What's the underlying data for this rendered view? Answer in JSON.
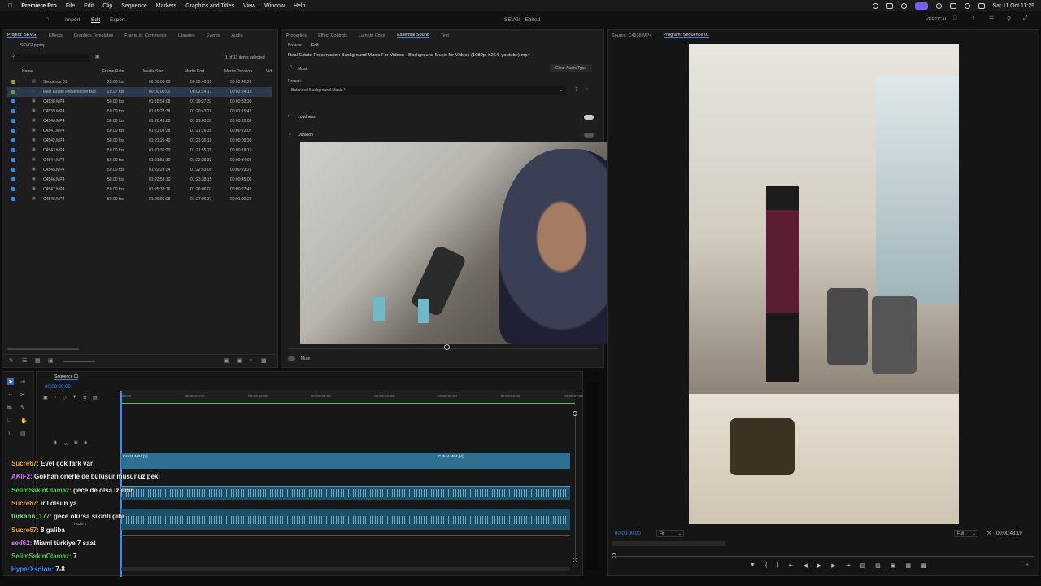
{
  "menubar": {
    "app": "Premiere Pro",
    "items": [
      "File",
      "Edit",
      "Clip",
      "Sequence",
      "Markers",
      "Graphics and Titles",
      "View",
      "Window",
      "Help"
    ],
    "datetime": "Sat 11 Oct 11:29"
  },
  "header": {
    "tab_import": "Import",
    "tab_edit": "Edit",
    "tab_export": "Export",
    "title": "SEVGI - Edited",
    "vertical": "VERTICAL"
  },
  "project": {
    "tabs": [
      "Project: SEVGI",
      "Effects",
      "Graphics Templates",
      "Frame.io: Comments",
      "Libraries",
      "Events",
      "Audio"
    ],
    "file": "SEVGI.prproj",
    "selected": "1 of 13 items selected",
    "columns": [
      "Name",
      "Frame Rate",
      "Media Start",
      "Media End",
      "Media Duration",
      "Vid"
    ],
    "rows": [
      [
        "Sequence 01",
        "25.00 fps",
        "00:00:00:00",
        "00:02:40:19",
        "00:02:40:20"
      ],
      [
        "Real Estate Presentation Bac",
        "29.97 fps",
        "00:00:00:00",
        "00:02:24:17",
        "00:02:24:18"
      ],
      [
        "C4538.MP4",
        "50.00 fps",
        "01:18:54:08",
        "01:19:27:37",
        "00:00:33:30"
      ],
      [
        "C4539.MP4",
        "50.00 fps",
        "01:19:27:38",
        "01:20:43:29",
        "00:01:15:42"
      ],
      [
        "C4540.MP4",
        "50.00 fps",
        "01:20:43:30",
        "01:21:03:37",
        "00:00:20:08"
      ],
      [
        "C4541.MP4",
        "50.00 fps",
        "01:21:03:38",
        "01:21:26:39",
        "00:00:23:02"
      ],
      [
        "C4542.MP4",
        "50.00 fps",
        "01:21:26:40",
        "01:21:36:19",
        "00:00:09:30"
      ],
      [
        "C4543.MP4",
        "50.00 fps",
        "01:21:36:20",
        "01:21:55:29",
        "00:00:19:10"
      ],
      [
        "C4544.MP4",
        "50.00 fps",
        "01:21:55:30",
        "01:22:29:33",
        "00:00:34:04"
      ],
      [
        "C4545.MP4",
        "50.00 fps",
        "01:22:29:34",
        "01:22:53:09",
        "00:00:23:26"
      ],
      [
        "C4546.MP4",
        "50.00 fps",
        "01:22:53:10",
        "01:23:38:15",
        "00:00:45:06"
      ],
      [
        "C4547.MP4",
        "50.00 fps",
        "01:25:38:16",
        "01:26:06:07",
        "00:00:27:42"
      ],
      [
        "C4548.MP4",
        "50.00 fps",
        "01:26:06:08",
        "01:27:06:31",
        "00:01:00:24"
      ]
    ]
  },
  "essential": {
    "tabs": [
      "Properties",
      "Effect Controls",
      "Lumetri Color",
      "Essential Sound",
      "Text"
    ],
    "sub_browse": "Browse",
    "sub_edit": "Edit",
    "clip_title": "Real Estate Presentation Background Music For Videos - Background Music for Videos (1080p, h264, youtube).mp4",
    "type": "Music",
    "clear": "Clear Audio Type",
    "preset_label": "Preset:",
    "preset_value": "Balanced Background Music *",
    "loudness": "Loudness",
    "duration": "Duration",
    "mute": "Mute"
  },
  "source": {
    "tab_source": "Source: C4538.MP4",
    "tab_program": "Program: Sequence 01",
    "timecode": "00:00:00:00",
    "fit": "Fit",
    "full": "Full",
    "duration": "00:00:43:19"
  },
  "timeline": {
    "tab": "Sequence 01",
    "timecode": "00:00:00:00",
    "ticks": [
      "00:00",
      "00:00:01:00",
      "00:00:02:00",
      "00:00:03:00",
      "00:00:04:00",
      "00:00:05:00",
      "00:00:06:00",
      "00:00:07:00"
    ],
    "clip1": "C4539.MP4 [V]",
    "clip2": "C4544.MP4 [V]",
    "v3": "V3",
    "audio_label": "Audio 1"
  },
  "chat": [
    {
      "user": "Sucre67:",
      "msg": "Evet çok fark var",
      "color": "#f2a33a"
    },
    {
      "user": "AKIF2:",
      "msg": "Gökhan önerle de buluşur musunuz peki",
      "color": "#d97cff"
    },
    {
      "user": "SelimSakinOlamaz:",
      "msg": "gece de olsa izlenir",
      "color": "#4fd24f"
    },
    {
      "user": "Sucre67:",
      "msg": "iril olsun ya",
      "color": "#f2a33a"
    },
    {
      "user": "furkann_177:",
      "msg": "gece olursa sıkıntı gibi",
      "color": "#7ee07e"
    },
    {
      "user": "Sucre67:",
      "msg": "8 galiba",
      "color": "#f2a33a"
    },
    {
      "user": "sed62:",
      "msg": "Miami türkiye 7 saat",
      "color": "#d97cff"
    },
    {
      "user": "SelimSakinOlamaz:",
      "msg": "7",
      "color": "#4fd24f"
    },
    {
      "user": "HyperXsdion:",
      "msg": "7-8",
      "color": "#3f8bff"
    }
  ]
}
